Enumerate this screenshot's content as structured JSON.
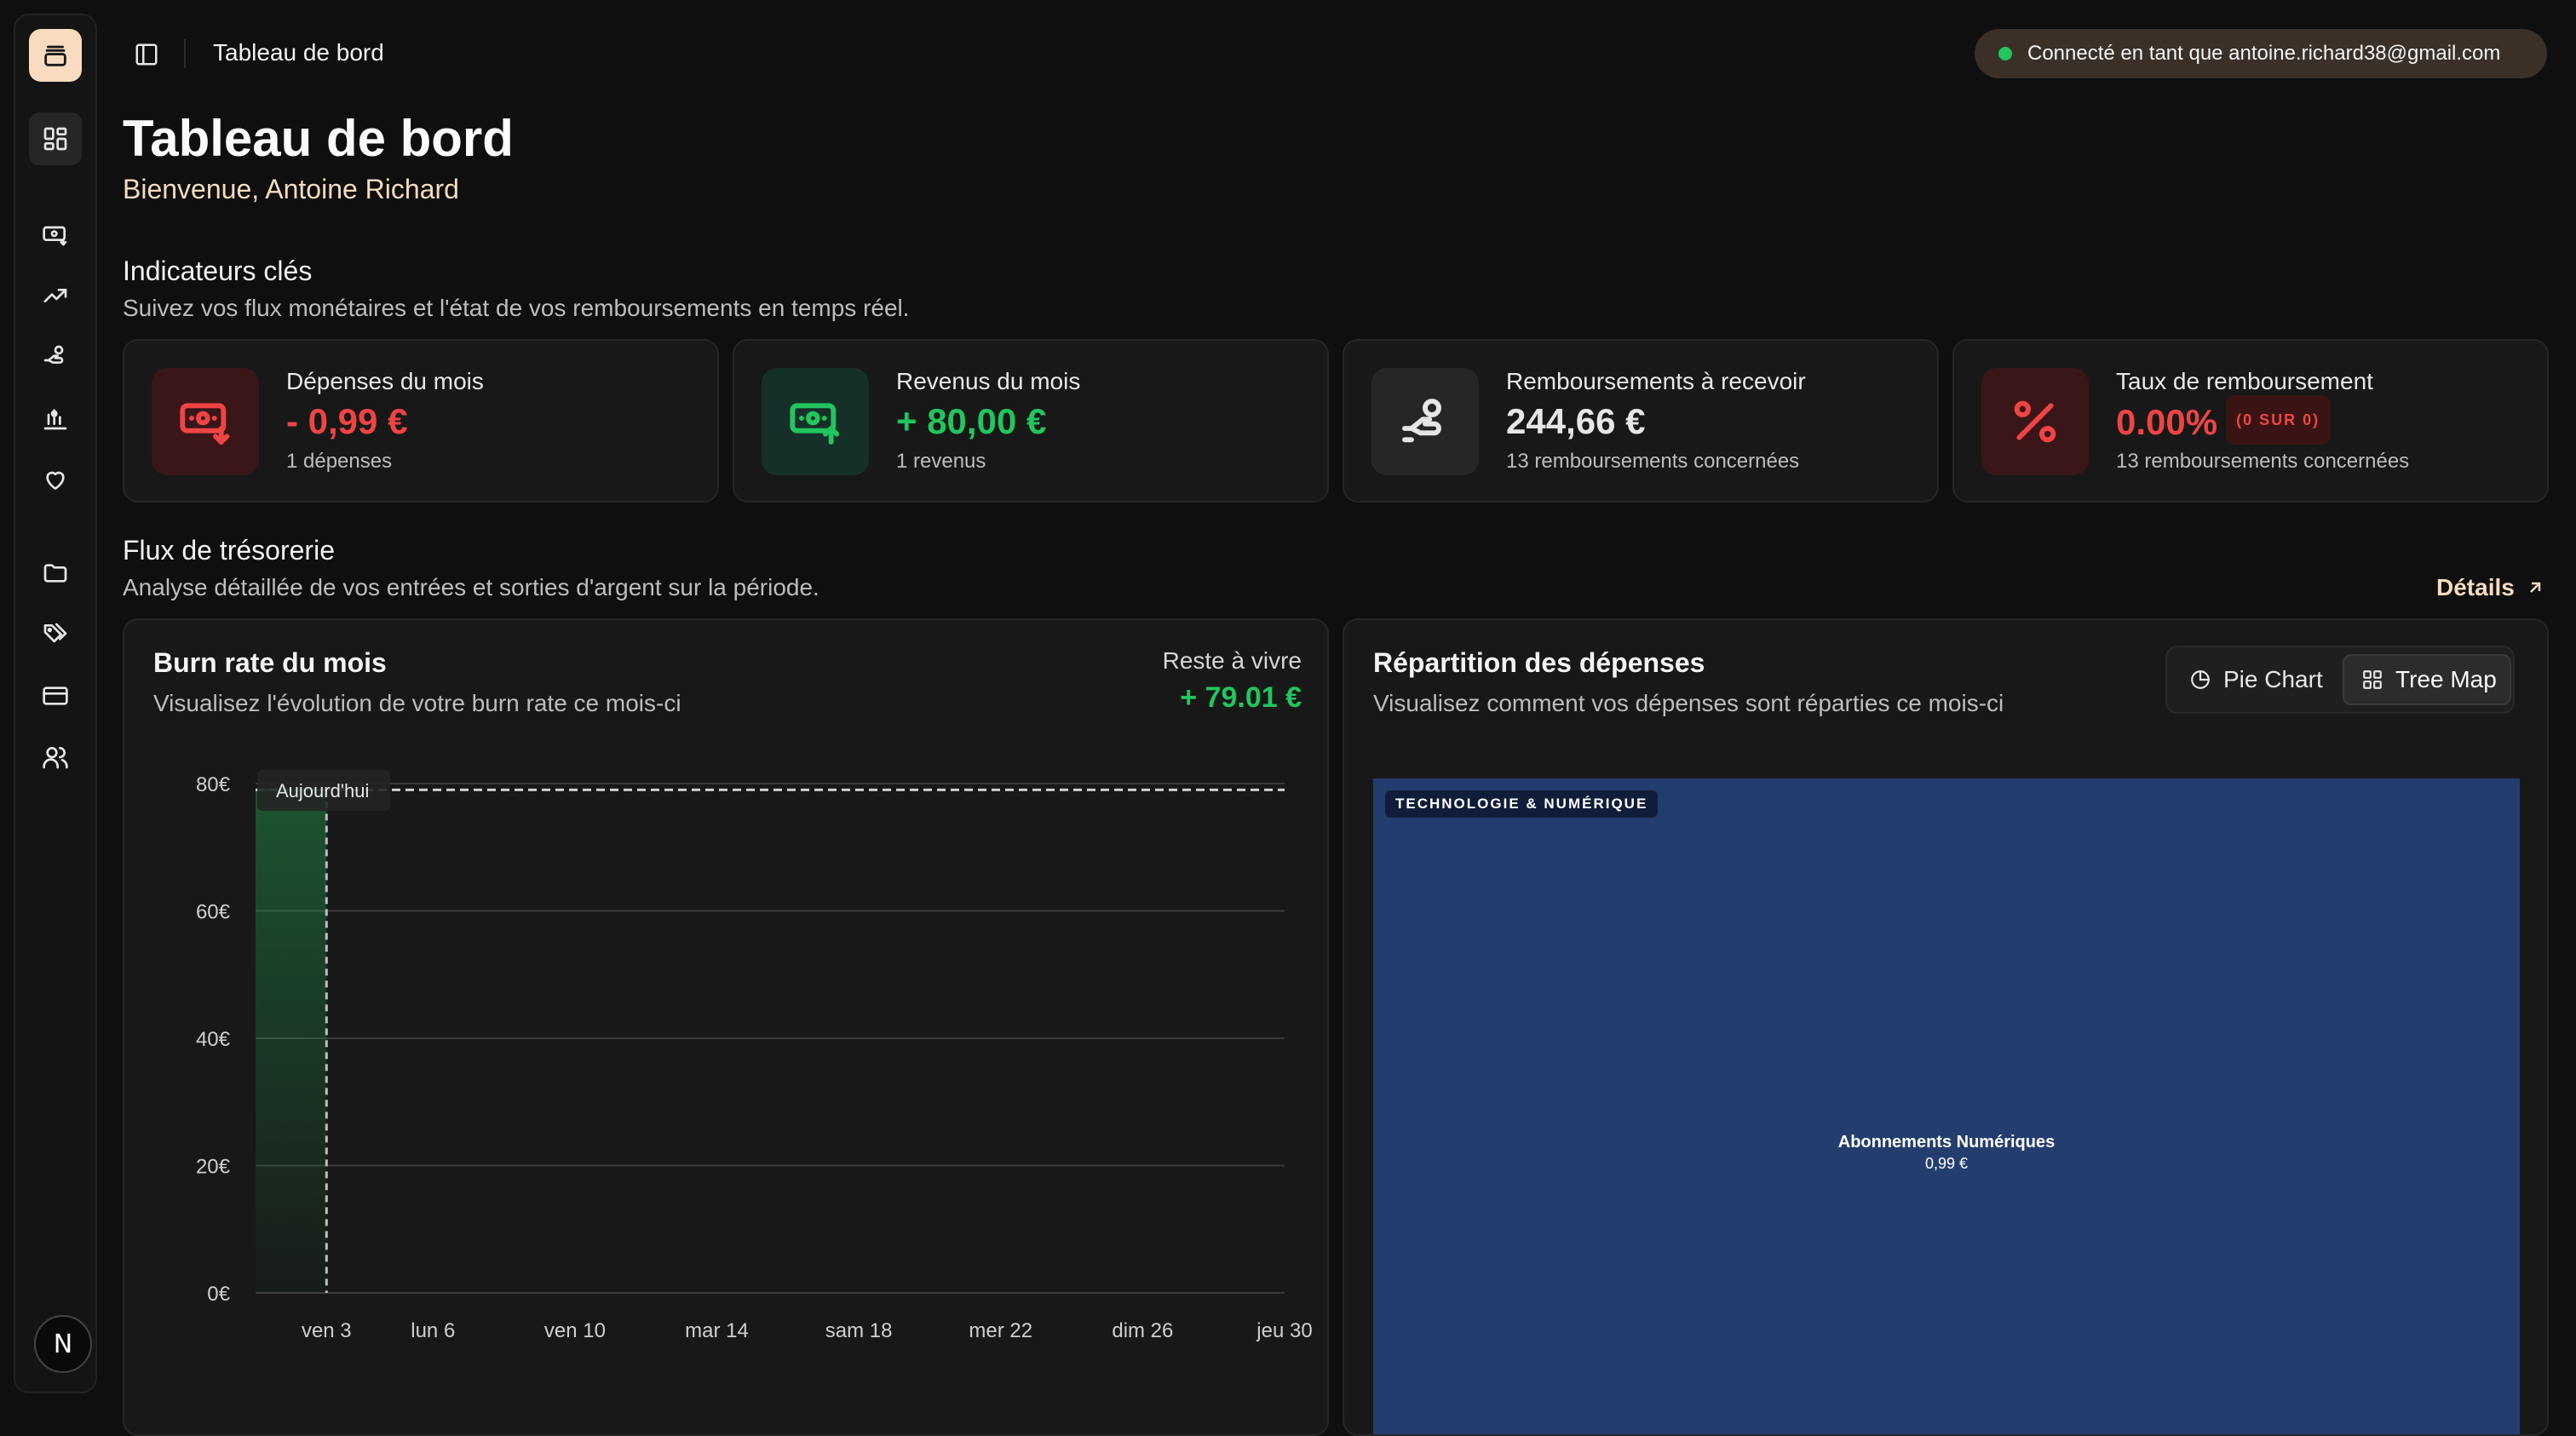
{
  "header": {
    "title": "Tableau de bord",
    "connected_text": "Connecté en tant que antoine.richard38@gmail.com",
    "status_color": "#22c55e"
  },
  "page": {
    "title": "Tableau de bord",
    "welcome": "Bienvenue, Antoine Richard"
  },
  "sidebar": {
    "avatar_initial": "N",
    "items": [
      {
        "icon": "dashboard-icon",
        "active": true
      },
      {
        "icon": "expenses-icon"
      },
      {
        "icon": "trending-up-icon"
      },
      {
        "icon": "reimbursement-hand-icon"
      },
      {
        "icon": "budget-chart-icon"
      },
      {
        "icon": "heart-icon"
      },
      {
        "icon": "folder-icon"
      },
      {
        "icon": "tags-icon"
      },
      {
        "icon": "credit-card-icon"
      },
      {
        "icon": "users-icon"
      }
    ]
  },
  "kpi_section": {
    "title": "Indicateurs clés",
    "subtitle": "Suivez vos flux monétaires et l'état de vos remboursements en temps réel."
  },
  "kpis": [
    {
      "label": "Dépenses du mois",
      "value": "- 0,99 €",
      "note": "1 dépenses",
      "color": "#ef4444",
      "icon": "banknote-down-icon"
    },
    {
      "label": "Revenus du mois",
      "value": "+ 80,00 €",
      "note": "1 revenus",
      "color": "#22c55e",
      "icon": "banknote-up-icon"
    },
    {
      "label": "Remboursements à recevoir",
      "value": "244,66 €",
      "note": "13 remboursements concernées",
      "color": "#e6e6e6",
      "icon": "hand-coins-icon"
    },
    {
      "label": "Taux de remboursement",
      "value": "0.00%",
      "badge": "(0 SUR 0)",
      "note": "13 remboursements concernées",
      "color": "#ef4444",
      "icon": "percent-icon"
    }
  ],
  "flux_section": {
    "title": "Flux de trésorerie",
    "subtitle": "Analyse détaillée de vos entrées et sorties d'argent sur la période.",
    "details_label": "Détails"
  },
  "burn_panel": {
    "title": "Burn rate du mois",
    "subtitle": "Visualisez l'évolution de votre burn rate ce mois-ci",
    "rav_label": "Reste à vivre",
    "rav_value": "+ 79.01 €",
    "today_label": "Aujourd'hui"
  },
  "chart_data": {
    "type": "area",
    "x_tick_labels": [
      "ven 3",
      "lun 6",
      "ven 10",
      "mar 14",
      "sam 18",
      "mer 22",
      "dim 26",
      "jeu 30"
    ],
    "x_tick_days": [
      3,
      6,
      10,
      14,
      18,
      22,
      26,
      30
    ],
    "x_range": [
      1,
      30
    ],
    "y_tick_labels": [
      "80€",
      "60€",
      "40€",
      "20€",
      "0€"
    ],
    "y_ticks": [
      80,
      60,
      40,
      20,
      0
    ],
    "ylim": [
      0,
      80
    ],
    "series": [
      {
        "x": [
          1,
          3
        ],
        "values": [
          79.01,
          79.01
        ]
      }
    ],
    "today_day": 3,
    "reference_value": 79.01,
    "area_color": "#22c55e",
    "grid": true
  },
  "split_panel": {
    "title": "Répartition des dépenses",
    "subtitle": "Visualisez comment vos dépenses sont réparties ce mois-ci",
    "pie_label": "Pie Chart",
    "tree_label": "Tree Map",
    "active_view": "Tree Map"
  },
  "treemap": {
    "category": "TECHNOLOGIE & NUMÉRIQUE",
    "label": "Abonnements Numériques",
    "value": "0,99 €",
    "color": "#233d6e"
  }
}
